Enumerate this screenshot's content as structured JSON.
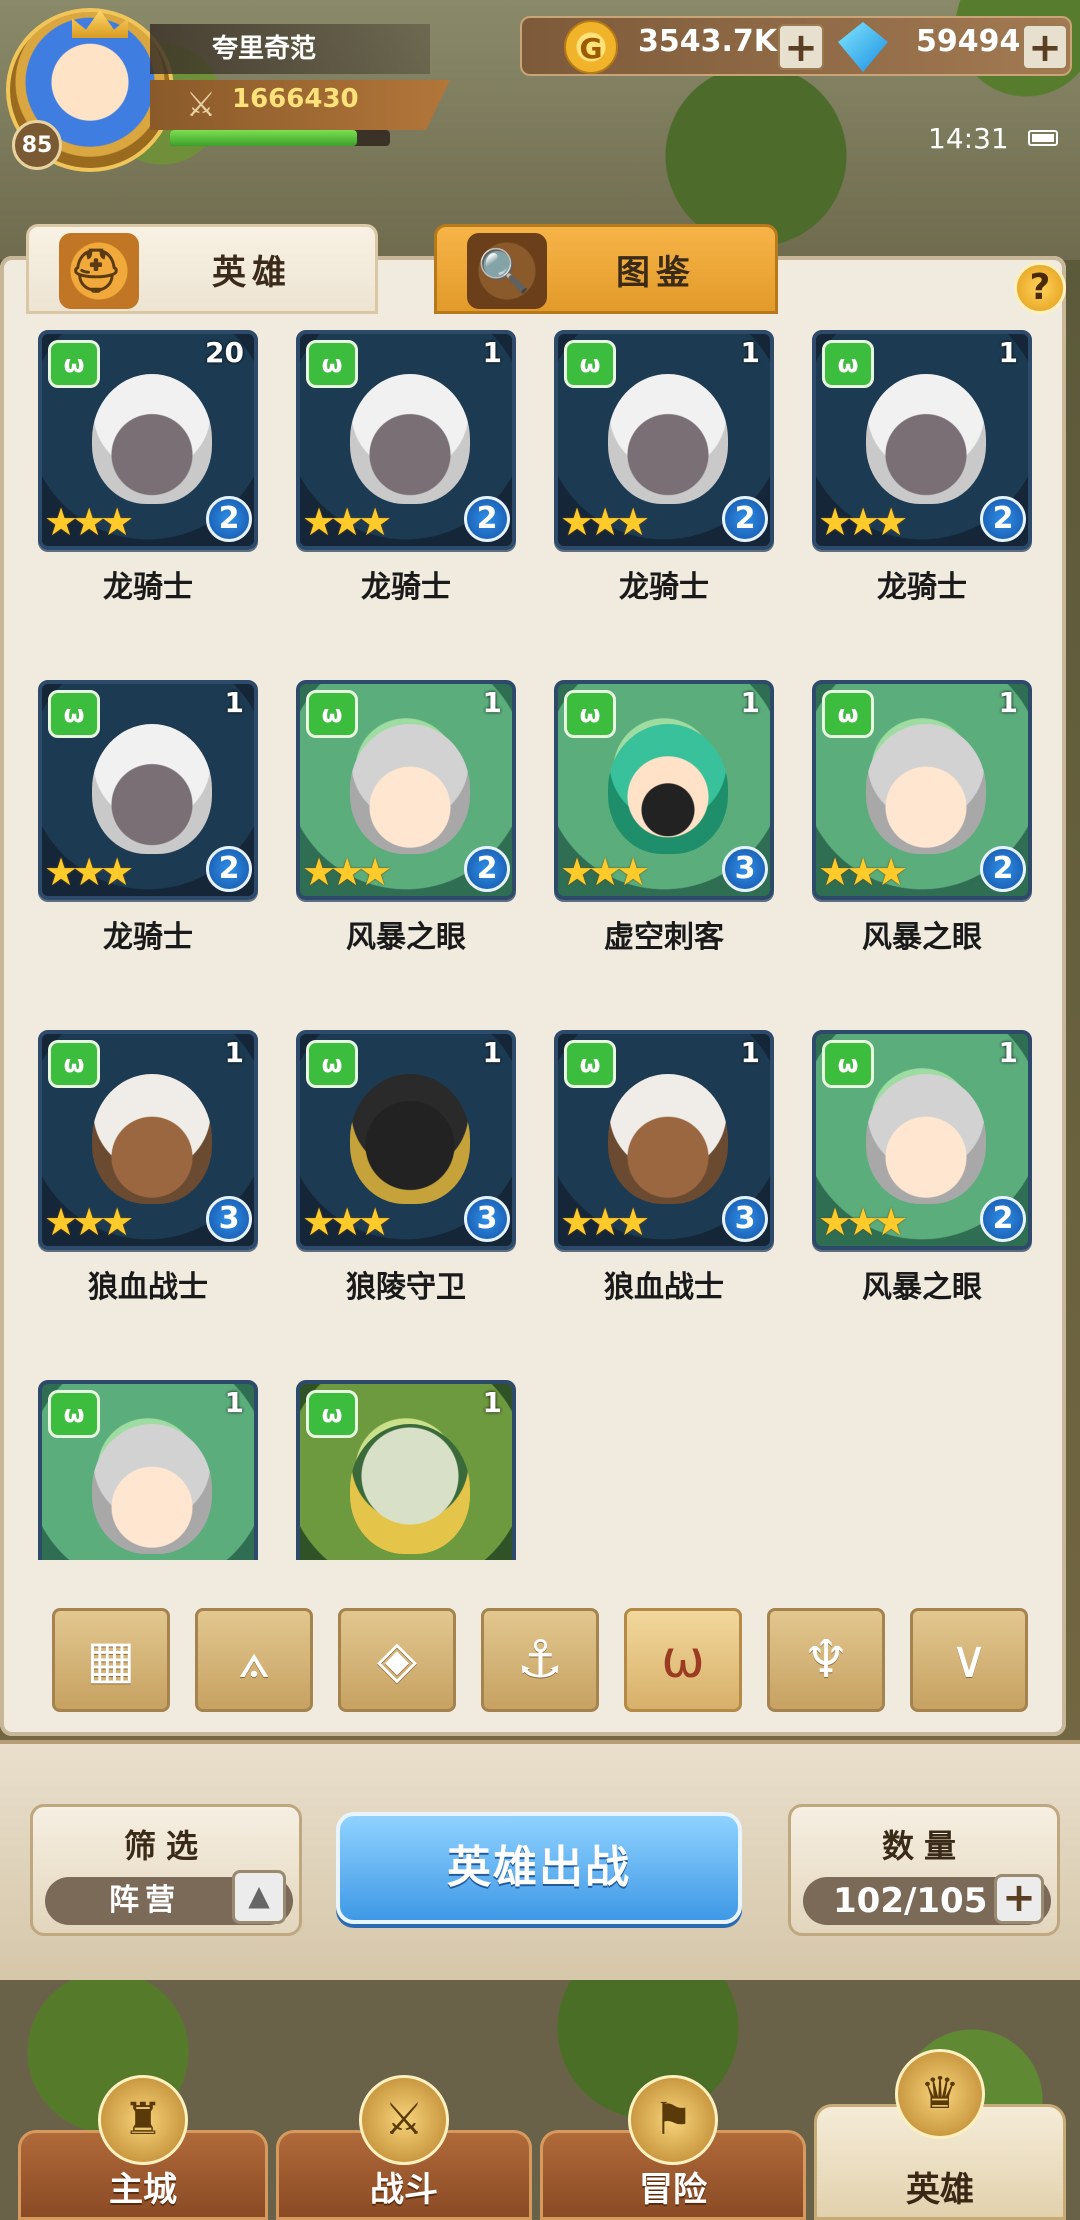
{
  "player": {
    "name": "夸里奇范",
    "level": "85",
    "power": "1666430",
    "exp_fraction": 0.85
  },
  "currency": {
    "gold": "3543.7K",
    "gems": "59494",
    "gold_icon_letter": "G"
  },
  "status": {
    "time": "14:31"
  },
  "tabs": [
    {
      "label": "英雄",
      "active": true
    },
    {
      "label": "图鉴",
      "active": false
    }
  ],
  "help_label": "?",
  "heroes": [
    {
      "name": "龙骑士",
      "level": "20",
      "rank": "2",
      "stars": "★★★",
      "portrait": "dragon"
    },
    {
      "name": "龙骑士",
      "level": "1",
      "rank": "2",
      "stars": "★★★",
      "portrait": "dragon"
    },
    {
      "name": "龙骑士",
      "level": "1",
      "rank": "2",
      "stars": "★★★",
      "portrait": "dragon"
    },
    {
      "name": "龙骑士",
      "level": "1",
      "rank": "2",
      "stars": "★★★",
      "portrait": "dragon"
    },
    {
      "name": "龙骑士",
      "level": "1",
      "rank": "2",
      "stars": "★★★",
      "portrait": "dragon"
    },
    {
      "name": "风暴之眼",
      "level": "1",
      "rank": "2",
      "stars": "★★★",
      "portrait": "storm"
    },
    {
      "name": "虚空刺客",
      "level": "1",
      "rank": "3",
      "stars": "★★★",
      "portrait": "void"
    },
    {
      "name": "风暴之眼",
      "level": "1",
      "rank": "2",
      "stars": "★★★",
      "portrait": "storm"
    },
    {
      "name": "狼血战士",
      "level": "1",
      "rank": "3",
      "stars": "★★★",
      "portrait": "wolf"
    },
    {
      "name": "狼陵守卫",
      "level": "1",
      "rank": "3",
      "stars": "★★★",
      "portrait": "anubis"
    },
    {
      "name": "狼血战士",
      "level": "1",
      "rank": "3",
      "stars": "★★★",
      "portrait": "wolf"
    },
    {
      "name": "风暴之眼",
      "level": "1",
      "rank": "2",
      "stars": "★★★",
      "portrait": "storm"
    },
    {
      "name": "",
      "level": "1",
      "rank": "",
      "stars": "",
      "portrait": "storm"
    },
    {
      "name": "",
      "level": "1",
      "rank": "",
      "stars": "",
      "portrait": "owl"
    }
  ],
  "faction_filters": [
    {
      "icon": "all-grid-icon",
      "active": false
    },
    {
      "icon": "faction-leaf-icon",
      "active": false
    },
    {
      "icon": "faction-diamond-icon",
      "active": false
    },
    {
      "icon": "faction-anchor-icon",
      "active": false
    },
    {
      "icon": "faction-beast-icon",
      "active": true
    },
    {
      "icon": "faction-horned-icon",
      "active": false
    },
    {
      "icon": "faction-wing-icon",
      "active": false
    }
  ],
  "filter": {
    "title": "筛选",
    "value": "阵营"
  },
  "deploy_button": "英雄出战",
  "count": {
    "title": "数量",
    "value": "102/105"
  },
  "nav": [
    {
      "label": "主城",
      "active": false,
      "icon": "city-icon"
    },
    {
      "label": "战斗",
      "active": false,
      "icon": "swords-icon"
    },
    {
      "label": "冒险",
      "active": false,
      "icon": "adventure-icon"
    },
    {
      "label": "英雄",
      "active": true,
      "icon": "hero-helmet-icon"
    }
  ],
  "colors": {
    "active_tab": "#f5ecd8",
    "accent_blue": "#3f99e6",
    "faction_green": "#3dbd3d"
  }
}
